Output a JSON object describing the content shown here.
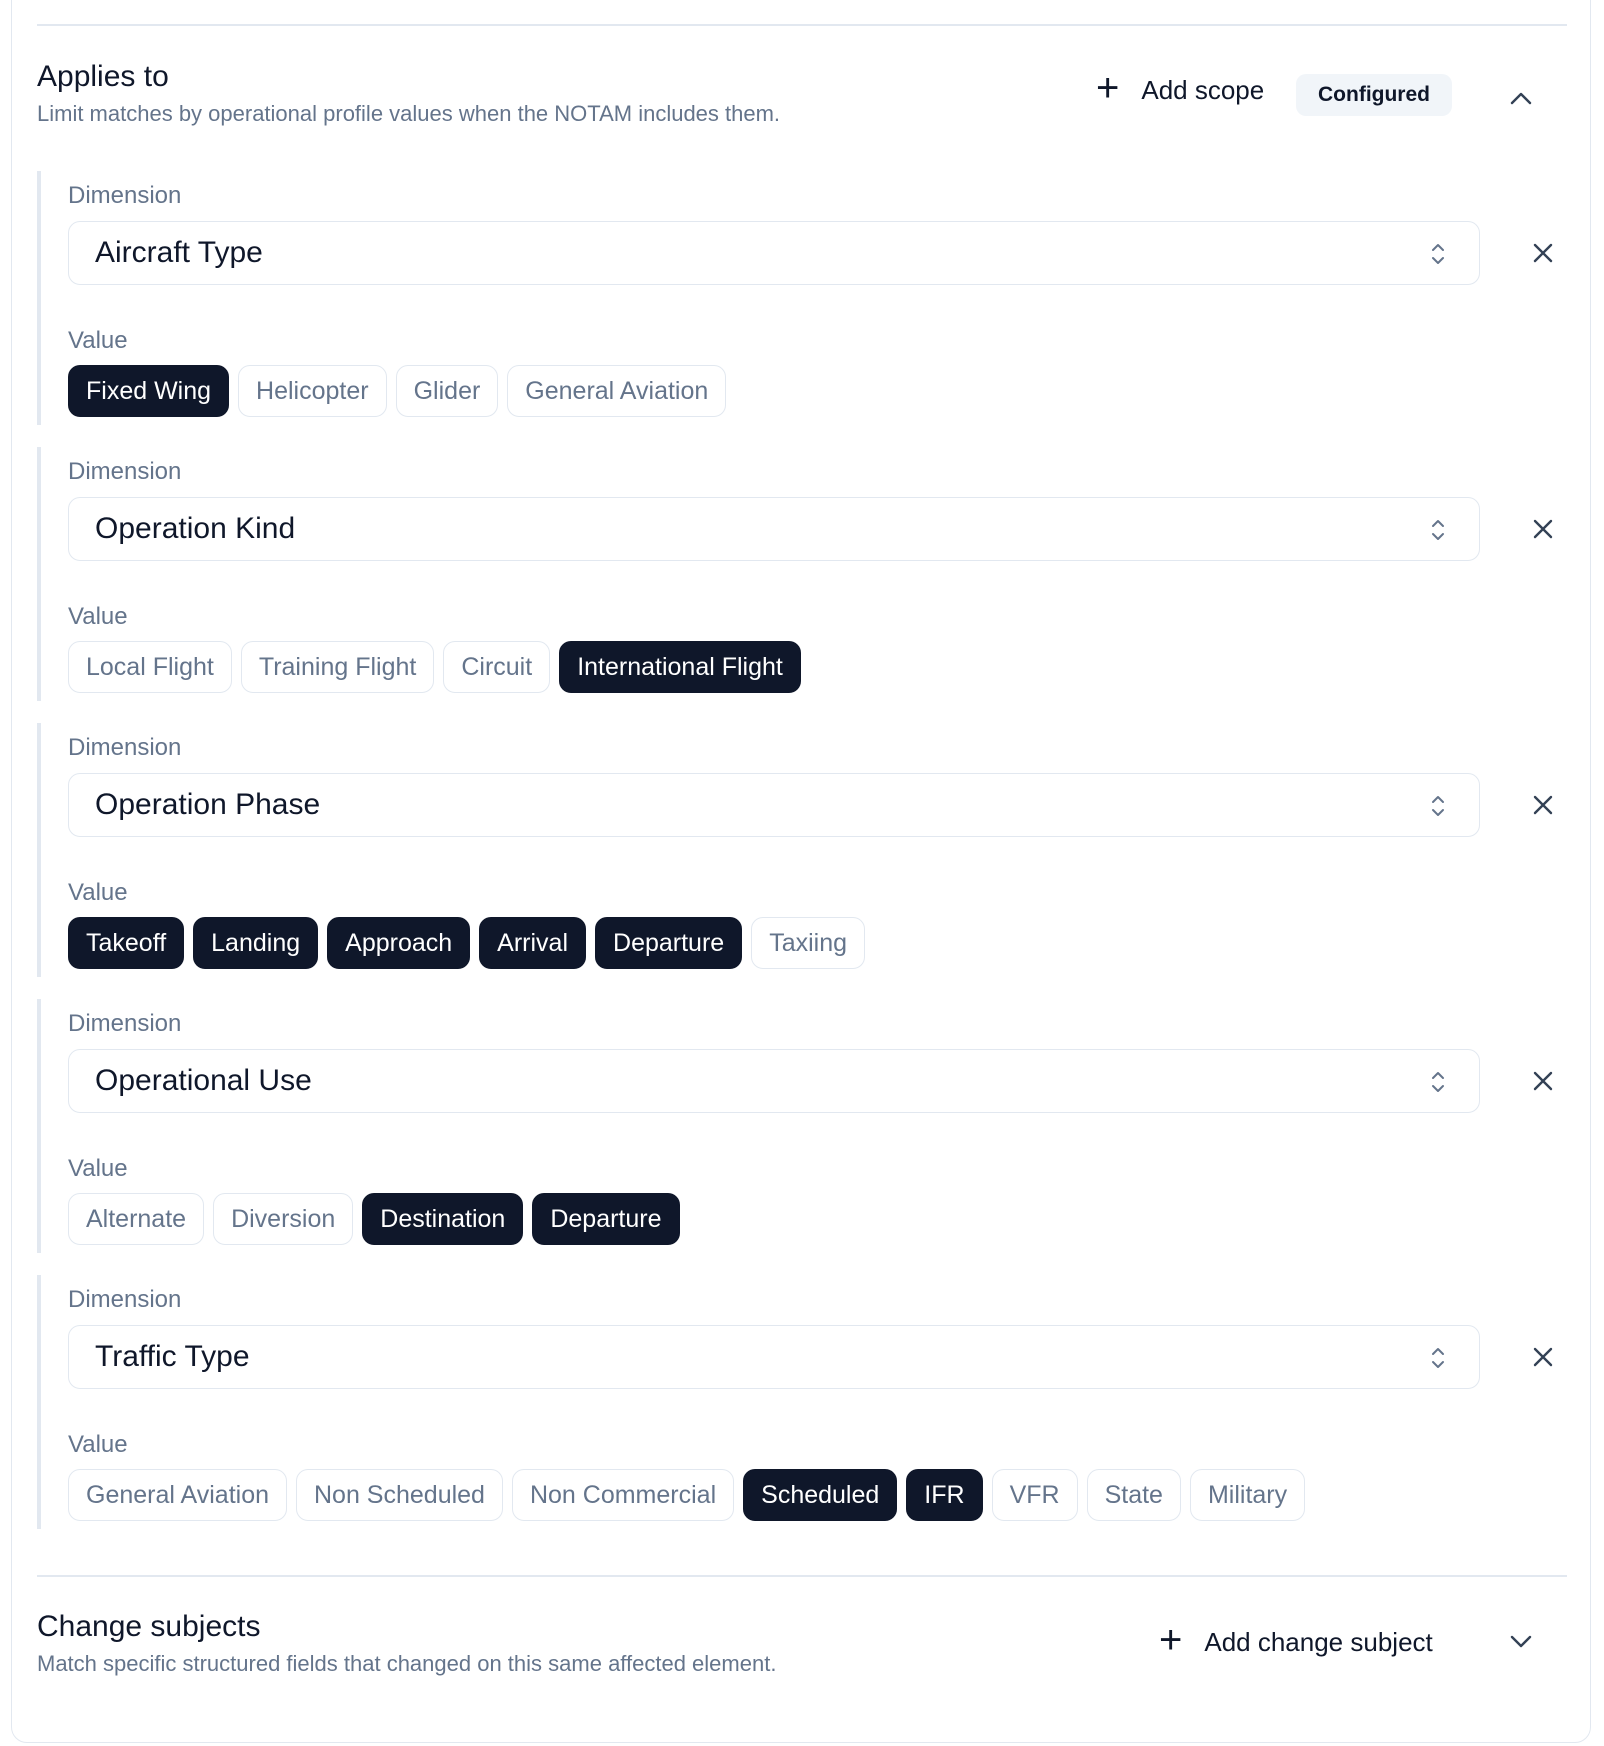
{
  "applies_to": {
    "title": "Applies to",
    "subtitle": "Limit matches by operational profile values when the NOTAM includes them.",
    "add_label": "Add scope",
    "status_badge": "Configured",
    "expanded": true,
    "dimension_label": "Dimension",
    "value_label": "Value",
    "scopes": [
      {
        "dimension": "Aircraft Type",
        "values": [
          {
            "label": "Fixed Wing",
            "selected": true
          },
          {
            "label": "Helicopter",
            "selected": false
          },
          {
            "label": "Glider",
            "selected": false
          },
          {
            "label": "General Aviation",
            "selected": false
          }
        ]
      },
      {
        "dimension": "Operation Kind",
        "values": [
          {
            "label": "Local Flight",
            "selected": false
          },
          {
            "label": "Training Flight",
            "selected": false
          },
          {
            "label": "Circuit",
            "selected": false
          },
          {
            "label": "International Flight",
            "selected": true
          }
        ]
      },
      {
        "dimension": "Operation Phase",
        "values": [
          {
            "label": "Takeoff",
            "selected": true
          },
          {
            "label": "Landing",
            "selected": true
          },
          {
            "label": "Approach",
            "selected": true
          },
          {
            "label": "Arrival",
            "selected": true
          },
          {
            "label": "Departure",
            "selected": true
          },
          {
            "label": "Taxiing",
            "selected": false
          }
        ]
      },
      {
        "dimension": "Operational Use",
        "values": [
          {
            "label": "Alternate",
            "selected": false
          },
          {
            "label": "Diversion",
            "selected": false
          },
          {
            "label": "Destination",
            "selected": true
          },
          {
            "label": "Departure",
            "selected": true
          }
        ]
      },
      {
        "dimension": "Traffic Type",
        "values": [
          {
            "label": "General Aviation",
            "selected": false
          },
          {
            "label": "Non Scheduled",
            "selected": false
          },
          {
            "label": "Non Commercial",
            "selected": false
          },
          {
            "label": "Scheduled",
            "selected": true
          },
          {
            "label": "IFR",
            "selected": true
          },
          {
            "label": "VFR",
            "selected": false
          },
          {
            "label": "State",
            "selected": false
          },
          {
            "label": "Military",
            "selected": false
          }
        ]
      }
    ]
  },
  "change_subjects": {
    "title": "Change subjects",
    "subtitle": "Match specific structured fields that changed on this same affected element.",
    "add_label": "Add change subject",
    "expanded": false
  },
  "icons": {
    "add": "plus-icon",
    "collapse": "chevron-up-icon",
    "expand": "chevron-down-icon",
    "select": "chevron-up-down-icon",
    "remove": "close-icon"
  },
  "colors": {
    "selected_chip_bg": "#0f172a",
    "selected_chip_text": "#ffffff",
    "muted_text": "#64748b",
    "border": "#e2e8f0",
    "badge_bg": "#f1f5f9"
  }
}
